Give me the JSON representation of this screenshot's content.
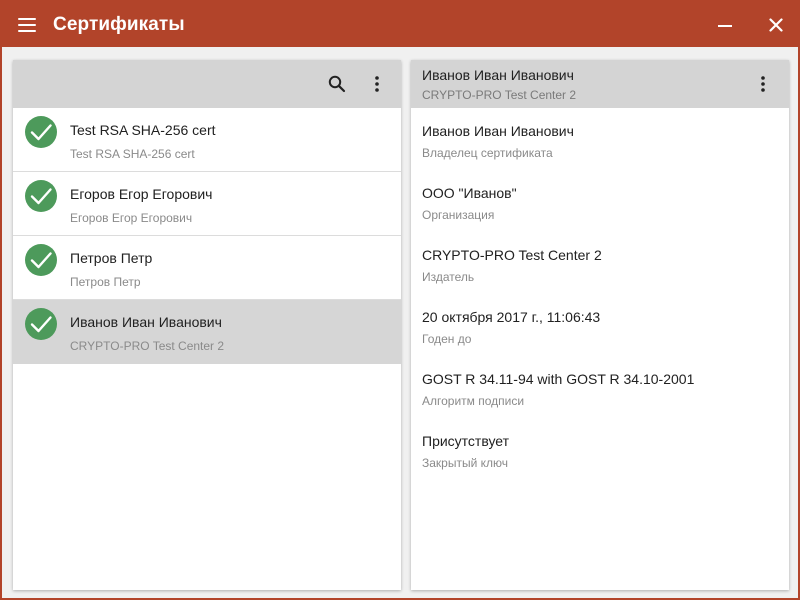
{
  "window": {
    "title": "Сертификаты"
  },
  "list": {
    "items": [
      {
        "primary": "Test RSA SHA-256 cert",
        "secondary": "Test RSA SHA-256 cert",
        "selected": false
      },
      {
        "primary": "Егоров Егор Егорович",
        "secondary": "Егоров Егор Егорович",
        "selected": false
      },
      {
        "primary": "Петров Петр",
        "secondary": "Петров Петр",
        "selected": false
      },
      {
        "primary": "Иванов Иван Иванович",
        "secondary": "CRYPTO-PRO Test Center 2",
        "selected": true
      }
    ]
  },
  "details": {
    "header_name": "Иванов Иван Иванович",
    "header_issuer": "CRYPTO-PRO Test Center 2",
    "fields": [
      {
        "value": "Иванов Иван Иванович",
        "label": "Владелец сертификата"
      },
      {
        "value": "ООО \"Иванов\"",
        "label": "Организация"
      },
      {
        "value": "CRYPTO-PRO Test Center 2",
        "label": "Издатель"
      },
      {
        "value": "20 октября 2017 г., 11:06:43",
        "label": "Годен до"
      },
      {
        "value": "GOST R 34.11-94 with GOST R 34.10-2001",
        "label": "Алгоритм подписи"
      },
      {
        "value": "Присутствует",
        "label": "Закрытый ключ"
      }
    ]
  },
  "icons": {
    "menu": "hamburger-menu-icon",
    "minimize": "minimize-icon",
    "close": "close-icon",
    "search": "search-icon",
    "more": "more-vertical-icon",
    "check": "check-circle-icon"
  },
  "colors": {
    "titlebar": "#b2442a",
    "check_green": "#4d9a5b",
    "toolbar_gray": "#d4d4d4",
    "selected_row": "#d6d6d6"
  }
}
